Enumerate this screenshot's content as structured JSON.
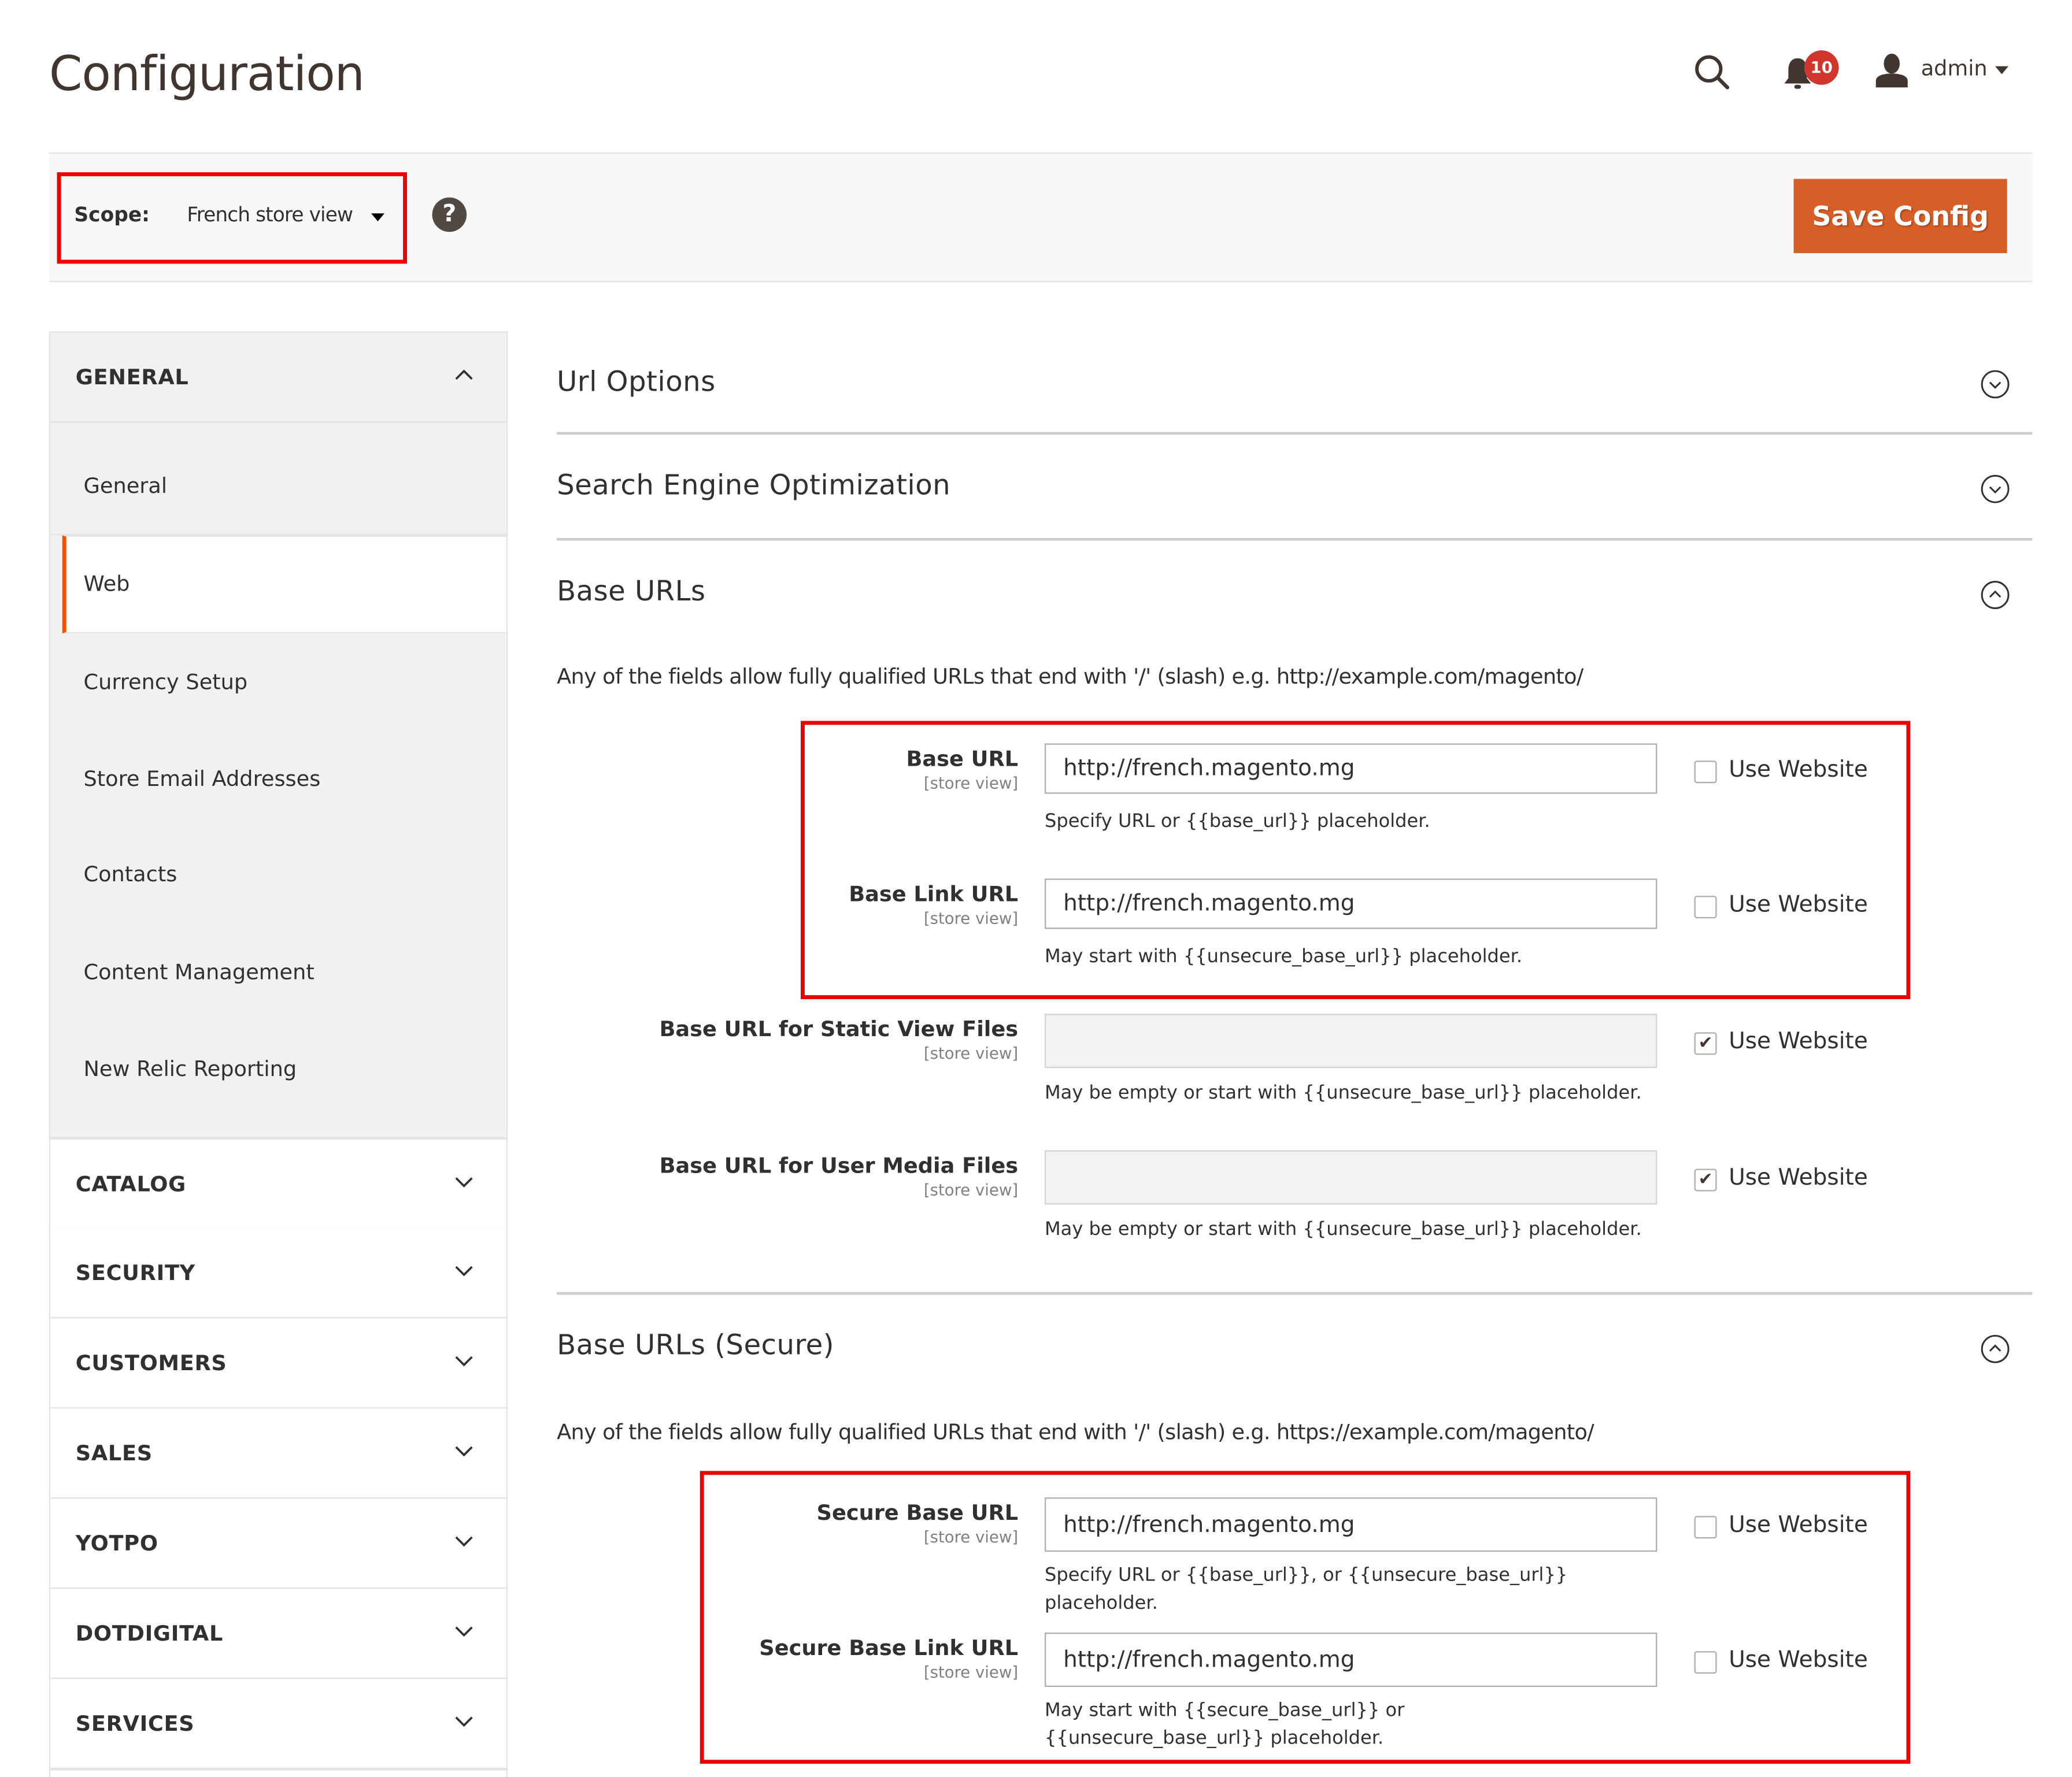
{
  "header": {
    "title": "Configuration",
    "notifications_count": "10",
    "user_name": "admin",
    "icons": {
      "search": "search-icon",
      "notifications": "bell-icon",
      "user": "user-icon"
    }
  },
  "scope_bar": {
    "scope_label": "Scope:",
    "scope_value": "French store view",
    "help_glyph": "?",
    "save_label": "Save Config"
  },
  "sidebar": {
    "groups": [
      {
        "label": "GENERAL",
        "expanded": true,
        "items": [
          {
            "label": "General",
            "active": false
          },
          {
            "label": "Web",
            "active": true
          },
          {
            "label": "Currency Setup",
            "active": false
          },
          {
            "label": "Store Email Addresses",
            "active": false
          },
          {
            "label": "Contacts",
            "active": false
          },
          {
            "label": "Content Management",
            "active": false
          },
          {
            "label": "New Relic Reporting",
            "active": false
          }
        ]
      },
      {
        "label": "CATALOG",
        "expanded": false
      },
      {
        "label": "SECURITY",
        "expanded": false
      },
      {
        "label": "CUSTOMERS",
        "expanded": false
      },
      {
        "label": "SALES",
        "expanded": false
      },
      {
        "label": "YOTPO",
        "expanded": false
      },
      {
        "label": "DOTDIGITAL",
        "expanded": false
      },
      {
        "label": "SERVICES",
        "expanded": false
      }
    ]
  },
  "sections": {
    "url_options": {
      "title": "Url Options",
      "expanded": false
    },
    "seo": {
      "title": "Search Engine Optimization",
      "expanded": false
    },
    "base_urls": {
      "title": "Base URLs",
      "expanded": true,
      "note": "Any of the fields allow fully qualified URLs that end with '/' (slash) e.g. http://example.com/magento/",
      "fields": [
        {
          "label": "Base URL",
          "scope": "[store view]",
          "value": "http://french.magento.mg",
          "hint": "Specify URL or {{base_url}} placeholder.",
          "use_website_label": "Use Website",
          "use_website": false
        },
        {
          "label": "Base Link URL",
          "scope": "[store view]",
          "value": "http://french.magento.mg",
          "hint": "May start with {{unsecure_base_url}} placeholder.",
          "use_website_label": "Use Website",
          "use_website": false
        },
        {
          "label": "Base URL for Static View Files",
          "scope": "[store view]",
          "value": "",
          "hint": "May be empty or start with {{unsecure_base_url}} placeholder.",
          "use_website_label": "Use Website",
          "use_website": true
        },
        {
          "label": "Base URL for User Media Files",
          "scope": "[store view]",
          "value": "",
          "hint": "May be empty or start with {{unsecure_base_url}} placeholder.",
          "use_website_label": "Use Website",
          "use_website": true
        }
      ]
    },
    "base_urls_secure": {
      "title": "Base URLs (Secure)",
      "expanded": true,
      "note": "Any of the fields allow fully qualified URLs that end with '/' (slash) e.g. https://example.com/magento/",
      "fields": [
        {
          "label": "Secure Base URL",
          "scope": "[store view]",
          "value": "http://french.magento.mg",
          "hint": "Specify URL or {{base_url}}, or {{unsecure_base_url}} placeholder.",
          "use_website_label": "Use Website",
          "use_website": false
        },
        {
          "label": "Secure Base Link URL",
          "scope": "[store view]",
          "value": "http://french.magento.mg",
          "hint": "May start with {{secure_base_url}} or {{unsecure_base_url}} placeholder.",
          "use_website_label": "Use Website",
          "use_website": false
        }
      ]
    }
  },
  "colors": {
    "accent": "#eb5202",
    "save_button": "#d85e27",
    "badge": "#d0362e",
    "highlight_box": "#ee0000",
    "text": "#303030"
  }
}
